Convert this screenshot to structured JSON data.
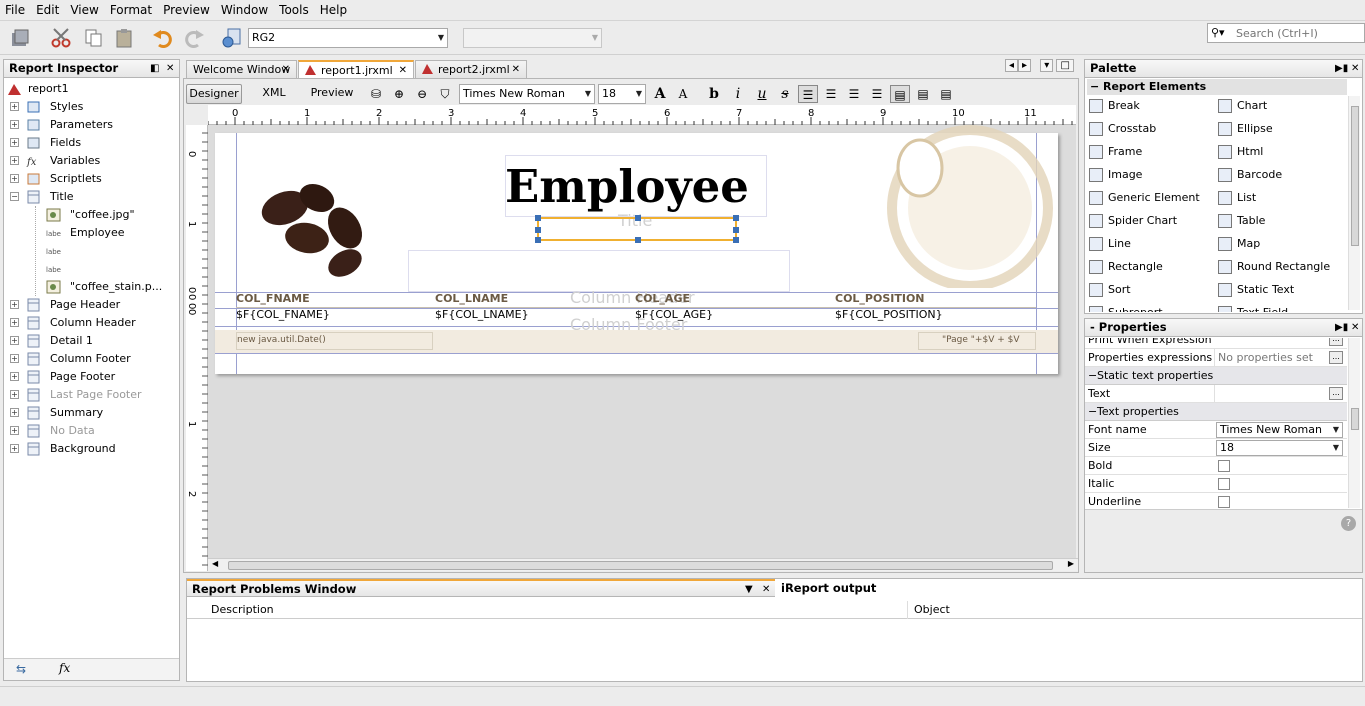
{
  "menu": [
    "File",
    "Edit",
    "View",
    "Format",
    "Preview",
    "Window",
    "Tools",
    "Help"
  ],
  "toolbar": {
    "combo_value": "RG2",
    "search_placeholder": "Search (Ctrl+I)"
  },
  "inspector": {
    "title": "Report Inspector",
    "root": "report1",
    "items": [
      {
        "label": "Styles",
        "indent": 1
      },
      {
        "label": "Parameters",
        "indent": 1
      },
      {
        "label": "Fields",
        "indent": 1
      },
      {
        "label": "Variables",
        "indent": 1
      },
      {
        "label": "Scriptlets",
        "indent": 1
      },
      {
        "label": "Title",
        "indent": 1
      },
      {
        "label": "\"coffee.jpg\"",
        "indent": 2
      },
      {
        "label": "Employee",
        "indent": 2
      },
      {
        "label": "",
        "indent": 2
      },
      {
        "label": "",
        "indent": 2
      },
      {
        "label": "\"coffee_stain.p...",
        "indent": 2
      },
      {
        "label": "Page Header",
        "indent": 1
      },
      {
        "label": "Column Header",
        "indent": 1
      },
      {
        "label": "Detail 1",
        "indent": 1
      },
      {
        "label": "Column Footer",
        "indent": 1
      },
      {
        "label": "Page Footer",
        "indent": 1
      },
      {
        "label": "Last Page Footer",
        "indent": 1
      },
      {
        "label": "Summary",
        "indent": 1
      },
      {
        "label": "No Data",
        "indent": 1
      },
      {
        "label": "Background",
        "indent": 1
      }
    ],
    "label_badge": "label"
  },
  "tabs": [
    "Welcome Window",
    "report1.jrxml",
    "report2.jrxml"
  ],
  "editor": {
    "modes": [
      "Designer",
      "XML",
      "Preview"
    ],
    "font": "Times New Roman",
    "size": "18",
    "ruler_h": [
      "0",
      "1",
      "2",
      "3",
      "4",
      "5",
      "6",
      "7",
      "8",
      "9",
      "10",
      "11"
    ],
    "ruler_v": [
      "0",
      "1",
      "0",
      "0",
      "0",
      "0",
      "1",
      "2"
    ]
  },
  "report": {
    "title": "Employee",
    "title_band": "Title",
    "column_header_band": "Column Header",
    "column_footer_band": "Column Footer",
    "headers": [
      "COL_FNAME",
      "COL_LNAME",
      "COL_AGE",
      "COL_POSITION"
    ],
    "fields": [
      "$F{COL_FNAME}",
      "$F{COL_LNAME}",
      "$F{COL_AGE}",
      "$F{COL_POSITION}"
    ],
    "footer_left": "new java.util.Date()",
    "footer_right": "\"Page \"+$V",
    " footer_right2": "\" \" + $V"
  },
  "problems": {
    "title": "Report Problems Window",
    "output_tab": "iReport output",
    "col_description": "Description",
    "col_object": "Object"
  },
  "palette": {
    "title": "Palette",
    "section": "Report Elements",
    "items": [
      "Break",
      "Chart",
      "Crosstab",
      "Ellipse",
      "Frame",
      "Html",
      "Image",
      "Barcode",
      "Generic Element",
      "List",
      "Spider Chart",
      "Table",
      "Line",
      "Map",
      "Rectangle",
      "Round Rectangle",
      "Sort",
      "Static Text",
      "Subreport",
      "Text Field"
    ]
  },
  "properties": {
    "title": "- Properties",
    "rows": [
      {
        "k": "Print When Expression",
        "v": ""
      },
      {
        "k": "Properties expressions",
        "v": "No properties set"
      }
    ],
    "sec_static": "Static text properties",
    "text_label": "Text",
    "sec_text": "Text properties",
    "font_name_label": "Font name",
    "font_name": "Times New Roman",
    "size_label": "Size",
    "size": "18",
    "bold": "Bold",
    "italic": "Italic",
    "underline": "Underline"
  }
}
